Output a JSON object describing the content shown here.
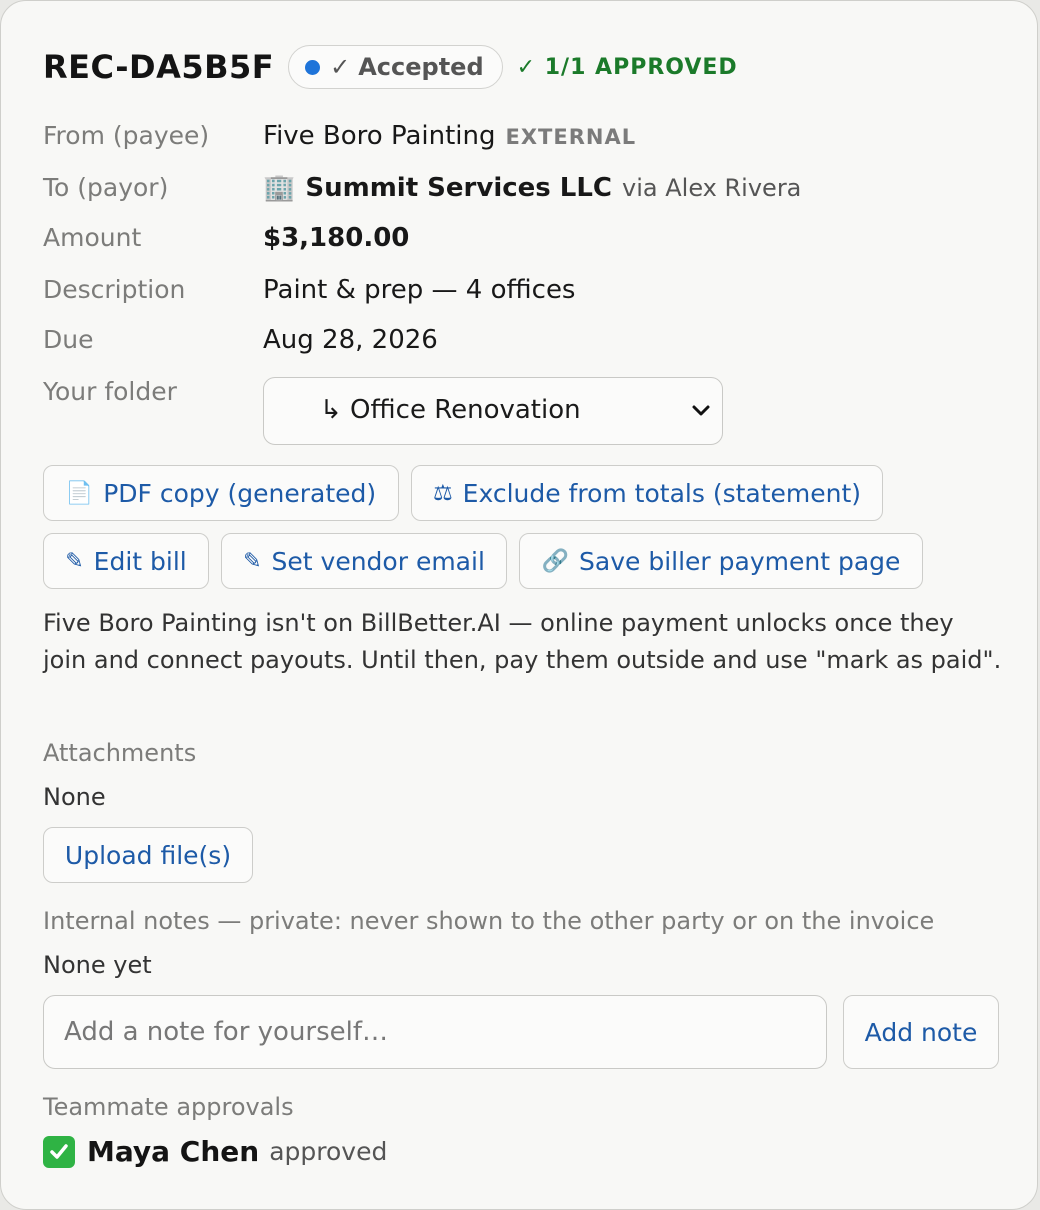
{
  "header": {
    "record_id": "REC-DA5B5F",
    "status": "Accepted",
    "approval_badge": "✓ 1/1 APPROVED"
  },
  "details": {
    "from_label": "From (payee)",
    "from_value": "Five Boro Painting",
    "from_tag": "EXTERNAL",
    "to_label": "To (payor)",
    "to_icon": "🏢",
    "to_value": "Summit Services LLC",
    "to_via": "via Alex Rivera",
    "amount_label": "Amount",
    "amount_value": "$3,180.00",
    "description_label": "Description",
    "description_value": "Paint & prep — 4 offices",
    "due_label": "Due",
    "due_value": "Aug 28, 2026",
    "folder_label": "Your folder",
    "folder_value": "↳ Office Renovation"
  },
  "actions": {
    "pdf_copy": "PDF copy (generated)",
    "exclude": "Exclude from totals (statement)",
    "edit_bill": "Edit bill",
    "set_vendor_email": "Set vendor email",
    "save_biller_page": "Save biller payment page"
  },
  "notice": "Five Boro Painting isn't on BillBetter.AI — online payment unlocks once they join and connect payouts. Until then, pay them outside and use \"mark as paid\".",
  "attachments": {
    "label": "Attachments",
    "value": "None",
    "upload_button": "Upload file(s)"
  },
  "internal_notes": {
    "label": "Internal notes — private: never shown to the other party or on the invoice",
    "value": "None yet",
    "placeholder": "Add a note for yourself…",
    "add_button": "Add note"
  },
  "approvals": {
    "label": "Teammate approvals",
    "name": "Maya Chen",
    "status": "approved"
  },
  "colors": {
    "link_blue": "#1d5aa7",
    "status_dot": "#1f74d9",
    "approved_green": "#1b7a2a"
  }
}
